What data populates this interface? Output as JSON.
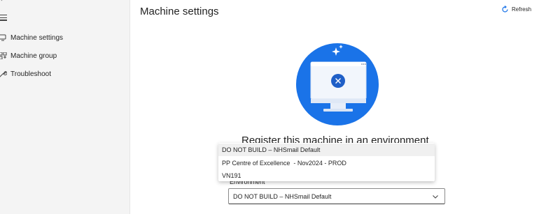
{
  "sidebar": {
    "back_icon": "arrow-left-icon",
    "menu_icon": "hamburger-icon",
    "items": [
      {
        "label": "Machine settings",
        "icon": "monitor-icon"
      },
      {
        "label": "Machine group",
        "icon": "group-icon"
      },
      {
        "label": "Troubleshoot",
        "icon": "wrench-icon"
      }
    ]
  },
  "header": {
    "title": "Machine settings",
    "refresh_label": "Refresh",
    "refresh_icon": "refresh-icon"
  },
  "hero": {
    "icon": "machine-error-illustration",
    "accent": "#1a73e8"
  },
  "main": {
    "heading": "Register this machine in an environment",
    "environment_label": "Environment",
    "environment_value": "DO NOT BUILD – NHSmail Default",
    "environment_options": [
      "DO NOT BUILD – NHSmail Default",
      "PP Centre of Excellence  - Nov2024 - PROD",
      "VN191"
    ]
  }
}
